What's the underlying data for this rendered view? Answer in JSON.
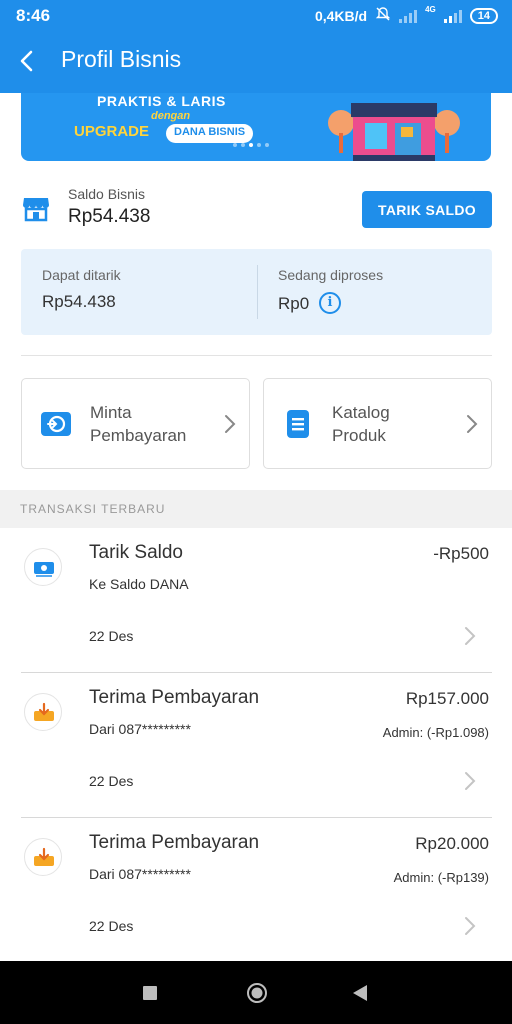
{
  "status_bar": {
    "time": "8:46",
    "network_speed": "0,4KB/d",
    "network_type": "4G",
    "battery": "14"
  },
  "app_bar": {
    "title": "Profil Bisnis",
    "back_icon": "arrow-left-icon"
  },
  "banner": {
    "line1": "PRAKTIS & LARIS",
    "line2": "dengan",
    "line3": "UPGRADE",
    "badge": "DANA BISNIS"
  },
  "saldo": {
    "label": "Saldo Bisnis",
    "value": "Rp54.438",
    "button": "TARIK SALDO"
  },
  "balances": {
    "withdrawable_label": "Dapat ditarik",
    "withdrawable_value": "Rp54.438",
    "processing_label": "Sedang diproses",
    "processing_value": "Rp0"
  },
  "actions": [
    {
      "line1": "Minta",
      "line2": "Pembayaran",
      "icon": "request-payment-icon"
    },
    {
      "line1": "Katalog",
      "line2": "Produk",
      "icon": "catalog-icon"
    }
  ],
  "section_title": "TRANSAKSI TERBARU",
  "transactions": [
    {
      "name": "Tarik Saldo",
      "sub": "Ke Saldo DANA",
      "amount": "-Rp500",
      "admin": "",
      "date": "22 Des",
      "icon": "withdraw-icon"
    },
    {
      "name": "Terima Pembayaran",
      "sub": "Dari 087*********",
      "amount": "Rp157.000",
      "admin": "Admin: (-Rp1.098)",
      "date": "22 Des",
      "icon": "receive-payment-icon"
    },
    {
      "name": "Terima Pembayaran",
      "sub": "Dari 087*********",
      "amount": "Rp20.000",
      "admin": "Admin: (-Rp139)",
      "date": "22 Des",
      "icon": "receive-payment-icon"
    }
  ],
  "colors": {
    "primary": "#1f8eea",
    "info_bg": "#e7f2fc",
    "accent_orange": "#f5a623",
    "banner_yellow": "#ffd43b"
  }
}
